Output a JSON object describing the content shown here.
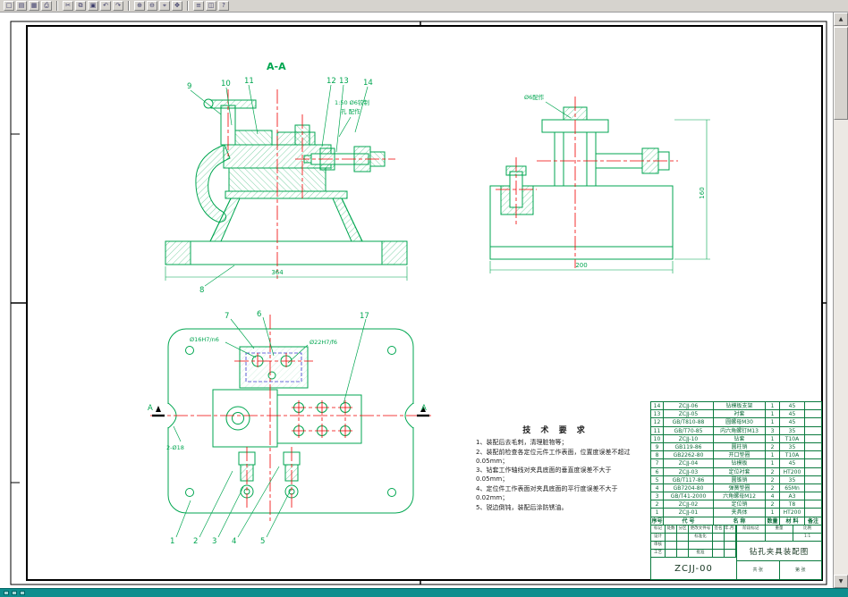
{
  "app": {
    "toolbar_icons": [
      {
        "name": "new-icon",
        "glyph": "□"
      },
      {
        "name": "open-icon",
        "glyph": "▤"
      },
      {
        "name": "save-icon",
        "glyph": "▦"
      },
      {
        "name": "print-icon",
        "glyph": "⎙"
      },
      {
        "name": "cut-icon",
        "glyph": "✂"
      },
      {
        "name": "copy-icon",
        "glyph": "⧉"
      },
      {
        "name": "paste-icon",
        "glyph": "▣"
      },
      {
        "name": "undo-icon",
        "glyph": "↶"
      },
      {
        "name": "redo-icon",
        "glyph": "↷"
      },
      {
        "name": "zoom-in-icon",
        "glyph": "⊕"
      },
      {
        "name": "zoom-out-icon",
        "glyph": "⊖"
      },
      {
        "name": "zoom-window-icon",
        "glyph": "⌖"
      },
      {
        "name": "pan-icon",
        "glyph": "✥"
      },
      {
        "name": "layers-icon",
        "glyph": "≡"
      },
      {
        "name": "properties-icon",
        "glyph": "◫"
      },
      {
        "name": "help-icon",
        "glyph": "?"
      }
    ],
    "scrollbar": {
      "up": "▲",
      "down": "▼"
    },
    "statusbar_color": "#0E8E8E"
  },
  "drawing": {
    "section_label": "A-A",
    "section_arrow_label": "A",
    "balloons": {
      "b1": "1",
      "b2": "2",
      "b3": "3",
      "b4": "4",
      "b5": "5",
      "b6": "6",
      "b7": "7",
      "b8": "8",
      "b9": "9",
      "b10": "10",
      "b11": "11",
      "b12": "12",
      "b13": "13",
      "b14": "14",
      "b17": "17"
    },
    "notes": {
      "taper1": "1:50 Ø6铰制",
      "taper2": "孔 配作",
      "side": "Ø6配作",
      "plan_label1": "Ø16H7/n6",
      "plan_label2": "Ø22H7/f6",
      "slot_label": "2-Ø18"
    },
    "dims": {
      "section_bottom": "364",
      "side_right": "160",
      "side_bottom": "200"
    }
  },
  "tech_requirements": {
    "title": "技 术 要 求",
    "items": [
      "1、装配后去毛刺，清理脏物等；",
      "2、装配前检查各定位元件工作表面，位置度误差不超过0.05mm；",
      "3、钻套工作轴线对夹具底面的垂直度误差不大于0.05mm；",
      "4、定位件工作表面对夹具底面的平行度误差不大于0.02mm；",
      "5、锐边倒钝，装配后涂防锈油。"
    ]
  },
  "bom": {
    "headers": [
      "序号",
      "代 号",
      "名 称",
      "数量",
      "材 料",
      "备注"
    ],
    "rows": [
      [
        "14",
        "ZCJJ-06",
        "钻模板支架",
        "1",
        "45",
        ""
      ],
      [
        "13",
        "ZCJJ-05",
        "衬套",
        "1",
        "45",
        ""
      ],
      [
        "12",
        "GB/T810-88",
        "圆螺母M30",
        "1",
        "45",
        ""
      ],
      [
        "11",
        "GB/T70-85",
        "内六角螺钉M13",
        "3",
        "35",
        ""
      ],
      [
        "10",
        "ZCJJ-10",
        "钻套",
        "1",
        "T10A",
        ""
      ],
      [
        "9",
        "GB119-86",
        "圆柱销",
        "2",
        "35",
        ""
      ],
      [
        "8",
        "GB2262-80",
        "开口垫圈",
        "1",
        "T10A",
        ""
      ],
      [
        "7",
        "ZCJJ-04",
        "钻模板",
        "1",
        "45",
        ""
      ],
      [
        "6",
        "ZCJJ-03",
        "定位衬套",
        "2",
        "HT200",
        ""
      ],
      [
        "5",
        "GB/T117-86",
        "圆锥销",
        "2",
        "35",
        ""
      ],
      [
        "4",
        "GB7204-80",
        "弹簧垫圈",
        "2",
        "65Mn",
        ""
      ],
      [
        "3",
        "GB/T41-2000",
        "六角螺母M12",
        "4",
        "A3",
        ""
      ],
      [
        "2",
        "ZCJJ-02",
        "定位销",
        "2",
        "T8",
        ""
      ],
      [
        "1",
        "ZCJJ-01",
        "夹具体",
        "1",
        "HT200",
        ""
      ]
    ]
  },
  "title_block": {
    "left_rows": [
      [
        "标记",
        "处数",
        "分区",
        "更改文件号",
        "签名",
        "年.月.日"
      ],
      [
        "设计",
        "",
        "",
        "标准化",
        "",
        ""
      ],
      [
        "审核",
        "",
        "",
        "",
        "",
        ""
      ],
      [
        "工艺",
        "",
        "",
        "批准",
        "",
        ""
      ]
    ],
    "stage_row": [
      "阶段标记",
      "重量",
      "比例"
    ],
    "stage_values": [
      "",
      "",
      "1:1"
    ],
    "drawing_title": "钻孔夹具装配图",
    "drawing_number": "ZCJJ-00",
    "sheet_row": [
      "共 张",
      "第 张"
    ]
  }
}
